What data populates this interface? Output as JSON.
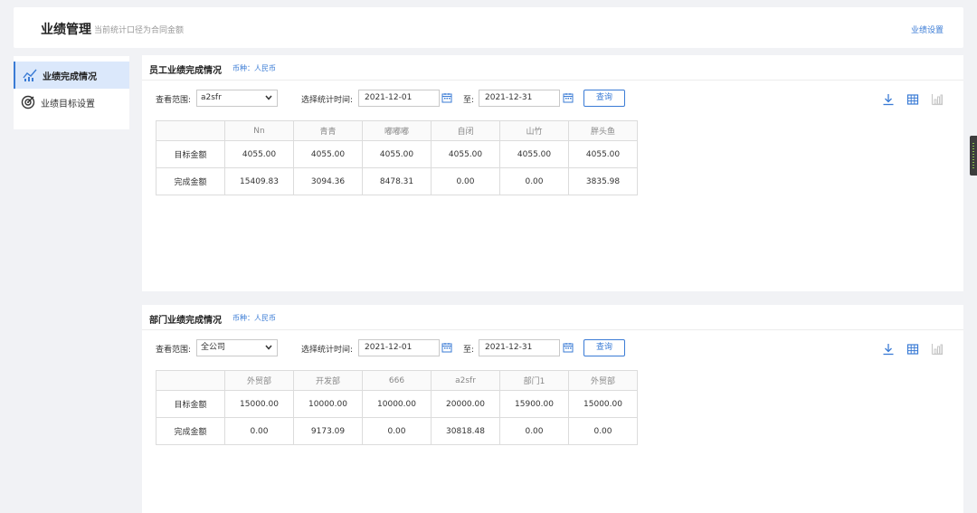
{
  "header": {
    "title": "业绩管理",
    "subtitle": "当前统计口径为合同金额",
    "settings_link": "业绩设置"
  },
  "sidebar": {
    "items": [
      {
        "label": "业绩完成情况",
        "icon": "chart-icon",
        "active": true
      },
      {
        "label": "业绩目标设置",
        "icon": "target-icon",
        "active": false
      }
    ]
  },
  "employee_panel": {
    "title": "员工业绩完成情况",
    "currency": "币种：人民币",
    "scope_label": "查看范围:",
    "scope_value": "a2sfr",
    "time_label": "选择统计时间:",
    "start_date": "2021-12-01",
    "to_label": "至:",
    "end_date": "2021-12-31",
    "query_label": "查询",
    "columns": [
      "Nn",
      "青青",
      "嘟嘟嘟",
      "自闭",
      "山竹",
      "胖头鱼"
    ],
    "rows": [
      {
        "label": "目标金额",
        "values": [
          "4055.00",
          "4055.00",
          "4055.00",
          "4055.00",
          "4055.00",
          "4055.00"
        ]
      },
      {
        "label": "完成金额",
        "values": [
          "15409.83",
          "3094.36",
          "8478.31",
          "0.00",
          "0.00",
          "3835.98"
        ]
      }
    ]
  },
  "department_panel": {
    "title": "部门业绩完成情况",
    "currency": "币种：人民币",
    "scope_label": "查看范围:",
    "scope_value": "全公司",
    "time_label": "选择统计时间:",
    "start_date": "2021-12-01",
    "to_label": "至:",
    "end_date": "2021-12-31",
    "query_label": "查询",
    "columns": [
      "外贸部",
      "开发部",
      "666",
      "a2sfr",
      "部门1",
      "外贸部"
    ],
    "rows": [
      {
        "label": "目标金额",
        "values": [
          "15000.00",
          "10000.00",
          "10000.00",
          "20000.00",
          "15900.00",
          "15000.00"
        ]
      },
      {
        "label": "完成金额",
        "values": [
          "0.00",
          "9173.09",
          "0.00",
          "30818.48",
          "0.00",
          "0.00"
        ]
      }
    ]
  },
  "colors": {
    "accent": "#3a7bd5",
    "active_bg": "#dbe8fb"
  }
}
